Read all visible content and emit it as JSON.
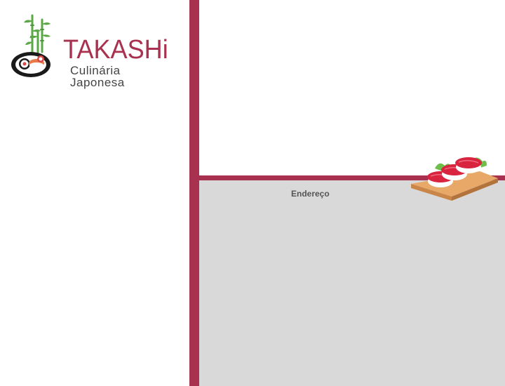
{
  "brand": {
    "name": "TAKASHi",
    "tagline": "Culinária Japonesa"
  },
  "content": {
    "address_label": "Endereço"
  },
  "colors": {
    "accent": "#a8314f",
    "panel": "#d9d9d9",
    "background": "#ffffff",
    "bamboo": "#5aa845"
  },
  "icons": {
    "logo": "sushi-bamboo-logo-icon",
    "decoration": "sushi-plate-icon"
  }
}
